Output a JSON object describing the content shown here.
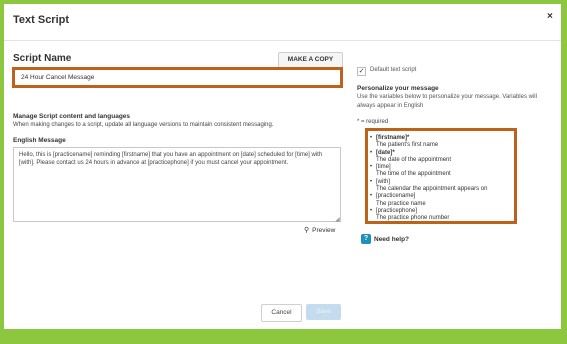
{
  "dialog": {
    "title": "Text Script",
    "close": "×"
  },
  "script_name": {
    "label": "Script Name",
    "copy_button": "MAKE A COPY",
    "value": "24 Hour Cancel Message"
  },
  "manage": {
    "title": "Manage Script content and languages",
    "subtitle": "When making changes to a script, update all language versions to maintain consistent messaging."
  },
  "english": {
    "label": "English Message",
    "message": "Hello, this is [practicename] reminding [firstname] that you have an appointment on [date] scheduled for [time] with [with]. Please contact us 24 hours in advance at [practicephone] if you must cancel your appointment.",
    "preview_label": "Preview"
  },
  "footer": {
    "cancel_label": "Cancel",
    "save_label": "Save"
  },
  "sidebar": {
    "default_checked": true,
    "default_label": "Default text script",
    "personalize_title": "Personalize your message",
    "personalize_desc": "Use the variables below to personalize your message. Variables will always appear in English",
    "required_note": "* = required",
    "variables": [
      {
        "name": "[firstname]*",
        "desc": "The patient's first name",
        "required": true
      },
      {
        "name": "[date]*",
        "desc": "The date of the appointment",
        "required": true
      },
      {
        "name": "[time]",
        "desc": "The time of the appointment",
        "required": false
      },
      {
        "name": "[with]",
        "desc": "The calendar the appointment appears on",
        "required": false
      },
      {
        "name": "[practicename]",
        "desc": "The practice name",
        "required": false
      },
      {
        "name": "[practicephone]",
        "desc": "The practice phone number",
        "required": false
      }
    ],
    "help_label": "Need help?"
  },
  "colors": {
    "background": "#8dc63f",
    "highlight_border": "#c0611b",
    "help_icon": "#1f8fbd"
  }
}
